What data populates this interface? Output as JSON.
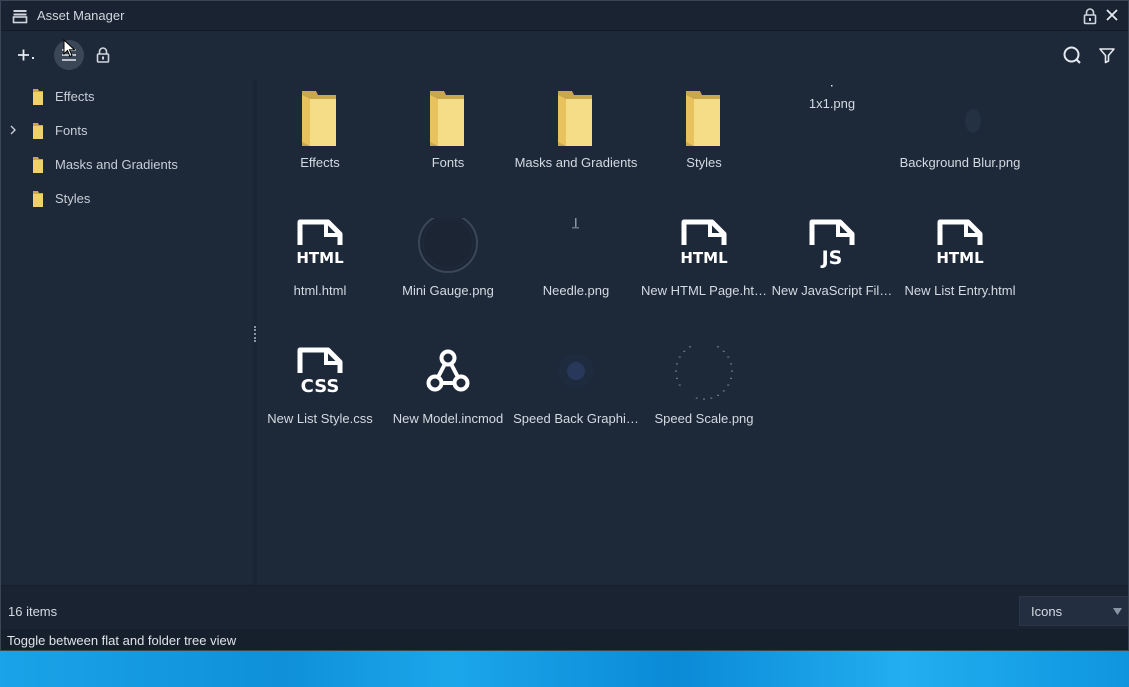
{
  "window": {
    "title": "Asset Manager",
    "status_count": "16 items",
    "view_mode": "Icons",
    "hint": "Toggle between flat and folder tree view"
  },
  "colors": {
    "background": "#1d2838",
    "folder": "#f0cf6d",
    "active_button": "#3b4657",
    "desktop": "#1aa3e8"
  },
  "toolbar": {
    "add_icon": "plus-dropdown-icon",
    "tree_toggle_icon": "hamburger-icon",
    "lock_icon": "lock-icon",
    "search_icon": "search-icon",
    "filter_icon": "filter-icon"
  },
  "tree": [
    {
      "label": "Effects",
      "expandable": false
    },
    {
      "label": "Fonts",
      "expandable": true
    },
    {
      "label": "Masks and Gradients",
      "expandable": false
    },
    {
      "label": "Styles",
      "expandable": false
    }
  ],
  "assets": [
    {
      "name": "Effects",
      "kind": "folder"
    },
    {
      "name": "Fonts",
      "kind": "folder"
    },
    {
      "name": "Masks and Gradients",
      "kind": "folder"
    },
    {
      "name": "Styles",
      "kind": "folder"
    },
    {
      "name": "1x1.png",
      "kind": "image-dot"
    },
    {
      "name": "Background Blur.png",
      "kind": "image-blur"
    },
    {
      "name": "html.html",
      "kind": "html"
    },
    {
      "name": "Mini Gauge.png",
      "kind": "image-gauge"
    },
    {
      "name": "Needle.png",
      "kind": "image-needle"
    },
    {
      "name": "New HTML Page.ht…",
      "kind": "html"
    },
    {
      "name": "New JavaScript Fil…",
      "kind": "js"
    },
    {
      "name": "New List Entry.html",
      "kind": "html"
    },
    {
      "name": "New List Style.css",
      "kind": "css"
    },
    {
      "name": "New Model.incmod",
      "kind": "model"
    },
    {
      "name": "Speed Back Graphi…",
      "kind": "image-speedback"
    },
    {
      "name": "Speed Scale.png",
      "kind": "image-scale"
    }
  ],
  "file_badges": {
    "html": "HTML",
    "js": "JS",
    "css": "CSS"
  }
}
